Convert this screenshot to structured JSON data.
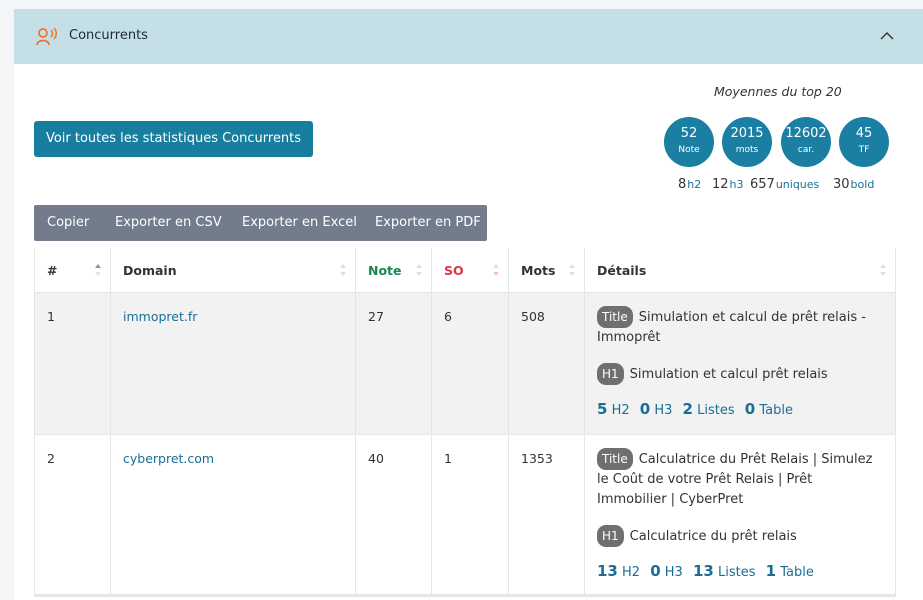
{
  "header": {
    "title": "Concurrents"
  },
  "stats_button": "Voir toutes les statistiques Concurrents",
  "averages": {
    "label": "Moyennes du top 20",
    "circles": [
      {
        "value": "52",
        "unit": "Note"
      },
      {
        "value": "2015",
        "unit": "mots"
      },
      {
        "value": "12602",
        "unit": "car."
      },
      {
        "value": "45",
        "unit": "TF"
      }
    ],
    "sub": [
      {
        "value": "8",
        "label": "h2"
      },
      {
        "value": "12",
        "label": "h3"
      },
      {
        "value": "657",
        "label": "uniques"
      },
      {
        "value": "30",
        "label": "bold"
      }
    ]
  },
  "export": [
    "Copier",
    "Exporter en CSV",
    "Exporter en Excel",
    "Exporter en PDF"
  ],
  "table": {
    "headers": [
      "#",
      "Domain",
      "Note",
      "SO",
      "Mots",
      "Détails"
    ],
    "header_colors": {
      "Note": "#198754",
      "SO": "#dc3545"
    },
    "rows": [
      {
        "rank": "1",
        "domain": "immopret.fr",
        "note": "27",
        "so": "6",
        "mots": "508",
        "title_badge": "Title",
        "title": "Simulation et calcul de prêt relais - Immoprêt",
        "h1_badge": "H1",
        "h1": "Simulation et calcul prêt relais",
        "counts": [
          {
            "n": "5",
            "l": "H2"
          },
          {
            "n": "0",
            "l": "H3"
          },
          {
            "n": "2",
            "l": "Listes"
          },
          {
            "n": "0",
            "l": "Table"
          }
        ]
      },
      {
        "rank": "2",
        "domain": "cyberpret.com",
        "note": "40",
        "so": "1",
        "mots": "1353",
        "title_badge": "Title",
        "title": "Calculatrice du Prêt Relais | Simulez le Coût de votre Prêt Relais | Prêt Immobilier | CyberPret",
        "h1_badge": "H1",
        "h1": "Calculatrice du prêt relais",
        "counts": [
          {
            "n": "13",
            "l": "H2"
          },
          {
            "n": "0",
            "l": "H3"
          },
          {
            "n": "13",
            "l": "Listes"
          },
          {
            "n": "1",
            "l": "Table"
          }
        ]
      }
    ]
  },
  "colors": {
    "accent": "#187ea0",
    "header_bg": "#c5dfe7",
    "export_bg": "#737c8b",
    "row_stripe": "#f2f2f2"
  },
  "icons": [
    "users-speaking-icon",
    "chevron-up-icon",
    "sort-icon"
  ]
}
